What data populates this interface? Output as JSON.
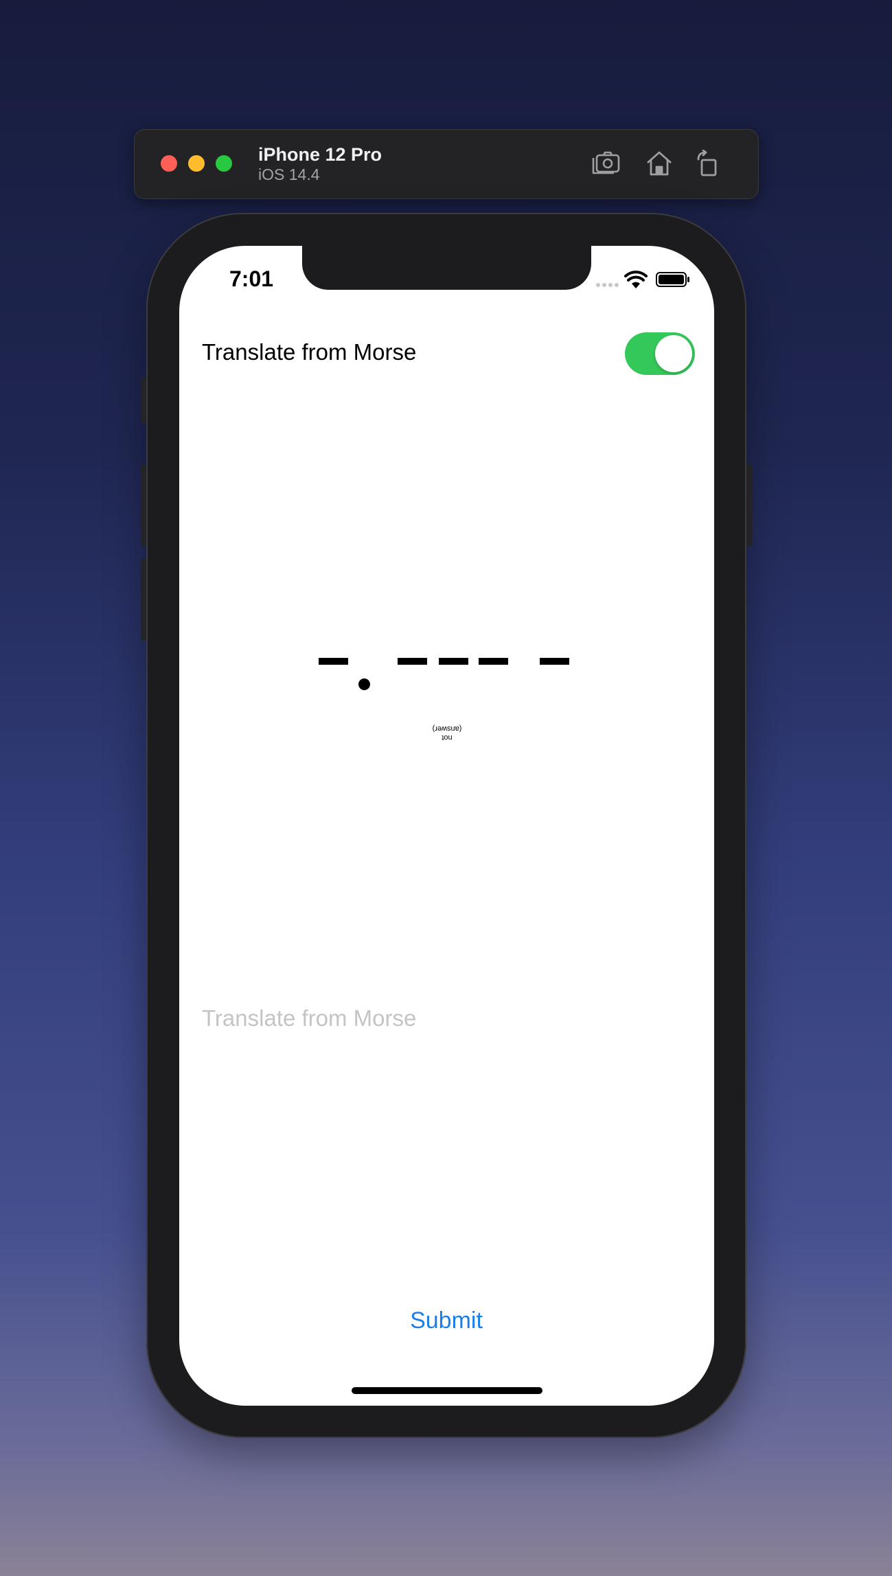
{
  "window": {
    "device_name": "iPhone 12 Pro",
    "os_version": "iOS 14.4",
    "toolbar_icons": [
      "screenshot-icon",
      "home-icon",
      "rotate-icon"
    ]
  },
  "status_bar": {
    "time": "7:01",
    "icons": [
      "cellular-dots-icon",
      "wifi-icon",
      "battery-icon"
    ]
  },
  "app": {
    "toggle_label": "Translate from Morse",
    "toggle_on": true,
    "morse_symbols": [
      "-",
      ".",
      "-",
      "-",
      "-",
      "-"
    ],
    "answer_hint": [
      "not",
      "(answer)"
    ],
    "input_value": "",
    "input_placeholder": "Translate from Morse",
    "submit_label": "Submit"
  },
  "colors": {
    "toggle_on": "#34c759",
    "link_blue": "#1b7fe6",
    "placeholder_gray": "#c4c4c6"
  }
}
